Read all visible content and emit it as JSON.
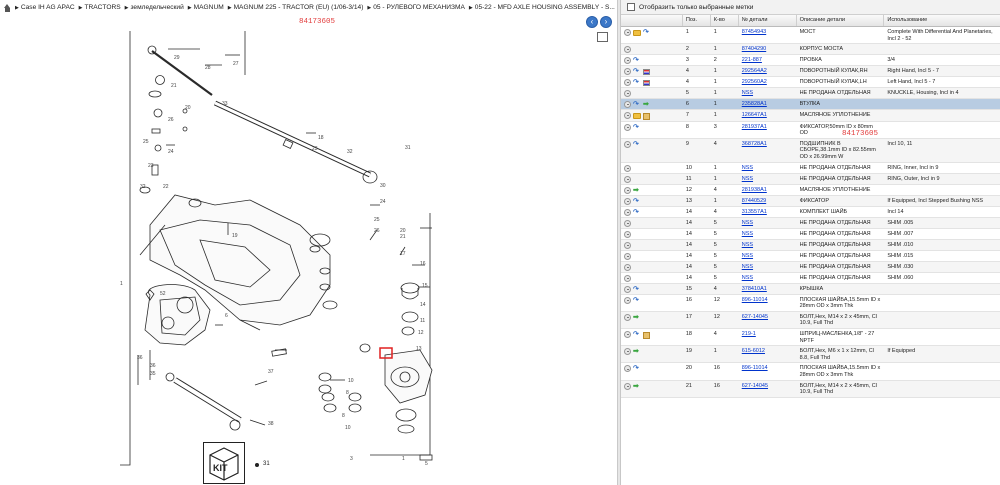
{
  "breadcrumb": [
    "Case IH AG APAC",
    "TRACTORS",
    "земледельческий",
    "MAGNUM",
    "MAGNUM 225 - TRACTOR (EU) (1/06-3/14)",
    "05 - РУЛЕВОГО МЕХАНИЗМА",
    "05-22 - MFD AXLE HOUSING ASSEMBLY - S..."
  ],
  "diagram": {
    "catalog_number": "84173605",
    "kit_label": "KIT",
    "kit_ref": "31"
  },
  "filter": {
    "label": "Отобразить только выбранные метки"
  },
  "table": {
    "headers": [
      "",
      "Поз.",
      "К-во",
      "№ детали",
      "Описание детали",
      "Использование"
    ],
    "selected_part_code": "84173605",
    "rows": [
      {
        "icons": [
          "plus",
          "folder",
          "return"
        ],
        "pos": "1",
        "qty": "1",
        "num": "87454943",
        "desc": "МОСТ",
        "use": "Complete With Differential And Planetaries, Incl 2 - 52"
      },
      {
        "icons": [
          "plus"
        ],
        "pos": "2",
        "qty": "1",
        "num": "87404290",
        "desc": "КОРПУС МОСТА",
        "use": ""
      },
      {
        "icons": [
          "plus",
          "return"
        ],
        "pos": "3",
        "qty": "2",
        "num": "221-887",
        "desc": "ПРОБКА",
        "use": "3/4"
      },
      {
        "icons": [
          "plus",
          "return",
          "flag"
        ],
        "pos": "4",
        "qty": "1",
        "num": "292564A2",
        "desc": "ПОВОРОТНЫЙ КУЛАК,RH",
        "use": "Right Hand, Incl 5 - 7"
      },
      {
        "icons": [
          "plus",
          "return",
          "flag"
        ],
        "pos": "4",
        "qty": "1",
        "num": "292560A2",
        "desc": "ПОВОРОТНЫЙ КУЛАК,LH",
        "use": "Left Hand, Incl 5 - 7"
      },
      {
        "icons": [
          "plus"
        ],
        "pos": "5",
        "qty": "1",
        "num": "NSS",
        "desc": "НЕ ПРОДАНА ОТДЕЛЬНАЯ",
        "use": "KNUCKLE, Housing, Incl in 4"
      },
      {
        "icons": [
          "plus",
          "return",
          "green"
        ],
        "pos": "6",
        "qty": "1",
        "num": "235828A1",
        "desc": "ВТУЛКА",
        "use": ""
      },
      {
        "icons": [
          "plus",
          "folder",
          "cube"
        ],
        "pos": "7",
        "qty": "1",
        "num": "126647A1",
        "desc": "МАСЛЯНОЕ УПЛОТНЕНИЕ",
        "use": ""
      },
      {
        "icons": [
          "plus",
          "return"
        ],
        "pos": "8",
        "qty": "3",
        "num": "281937A1",
        "desc": "ФИКСАТОР,50mm ID x 80mm OD",
        "use": ""
      },
      {
        "icons": [
          "plus",
          "return"
        ],
        "pos": "9",
        "qty": "4",
        "num": "368728A1",
        "desc": "ПОДШИПНИК В СБОРЕ,38.1mm ID x 82.55mm OD x 26.99mm W",
        "use": "Incl 10, 11"
      },
      {
        "icons": [
          "plus"
        ],
        "pos": "10",
        "qty": "1",
        "num": "NSS",
        "desc": "НЕ ПРОДАНА ОТДЕЛЬНАЯ",
        "use": "RING, Inner, Incl in 9"
      },
      {
        "icons": [
          "plus"
        ],
        "pos": "11",
        "qty": "1",
        "num": "NSS",
        "desc": "НЕ ПРОДАНА ОТДЕЛЬНАЯ",
        "use": "RING, Outer, Incl in 9"
      },
      {
        "icons": [
          "plus",
          "green"
        ],
        "pos": "12",
        "qty": "4",
        "num": "281938A1",
        "desc": "МАСЛЯНОЕ УПЛОТНЕНИЕ",
        "use": ""
      },
      {
        "icons": [
          "plus",
          "return"
        ],
        "pos": "13",
        "qty": "1",
        "num": "87440529",
        "desc": "ФИКСАТОР",
        "use": "If Equipped, Incl Stepped Bushing NSS"
      },
      {
        "icons": [
          "plus",
          "return"
        ],
        "pos": "14",
        "qty": "4",
        "num": "313557A1",
        "desc": "КОМПЛЕКТ ШАЙБ",
        "use": "Incl 14"
      },
      {
        "icons": [
          "plus"
        ],
        "pos": "14",
        "qty": "5",
        "num": "NSS",
        "desc": "НЕ ПРОДАНА ОТДЕЛЬНАЯ",
        "use": "SHIM .005"
      },
      {
        "icons": [
          "plus"
        ],
        "pos": "14",
        "qty": "5",
        "num": "NSS",
        "desc": "НЕ ПРОДАНА ОТДЕЛЬНАЯ",
        "use": "SHIM .007"
      },
      {
        "icons": [
          "plus"
        ],
        "pos": "14",
        "qty": "5",
        "num": "NSS",
        "desc": "НЕ ПРОДАНА ОТДЕЛЬНАЯ",
        "use": "SHIM .010"
      },
      {
        "icons": [
          "plus"
        ],
        "pos": "14",
        "qty": "5",
        "num": "NSS",
        "desc": "НЕ ПРОДАНА ОТДЕЛЬНАЯ",
        "use": "SHIM .015"
      },
      {
        "icons": [
          "plus"
        ],
        "pos": "14",
        "qty": "5",
        "num": "NSS",
        "desc": "НЕ ПРОДАНА ОТДЕЛЬНАЯ",
        "use": "SHIM .030"
      },
      {
        "icons": [
          "plus"
        ],
        "pos": "14",
        "qty": "5",
        "num": "NSS",
        "desc": "НЕ ПРОДАНА ОТДЕЛЬНАЯ",
        "use": "SHIM .060"
      },
      {
        "icons": [
          "plus",
          "return"
        ],
        "pos": "15",
        "qty": "4",
        "num": "378410A1",
        "desc": "КРЫШКА",
        "use": ""
      },
      {
        "icons": [
          "plus",
          "return"
        ],
        "pos": "16",
        "qty": "12",
        "num": "896-11014",
        "desc": "ПЛОСКАЯ ШАЙБА,15.5mm ID x 28mm OD x 3mm Thk",
        "use": ""
      },
      {
        "icons": [
          "plus",
          "green"
        ],
        "pos": "17",
        "qty": "12",
        "num": "627-14045",
        "desc": "БОЛТ,Hex, M14 x 2 x 45mm, Cl 10.9, Full Thd",
        "use": ""
      },
      {
        "icons": [
          "plus",
          "return",
          "cube"
        ],
        "pos": "18",
        "qty": "4",
        "num": "219-1",
        "desc": "ШПРИЦ-МАСЛЕНКА,1/8\" - 27 NPTF",
        "use": ""
      },
      {
        "icons": [
          "plus",
          "green"
        ],
        "pos": "19",
        "qty": "1",
        "num": "615-6012",
        "desc": "БОЛТ,Hex, M6 x 1 x 12mm, Cl 8.8, Full Thd",
        "use": "If Equipped"
      },
      {
        "icons": [
          "plus",
          "return"
        ],
        "pos": "20",
        "qty": "16",
        "num": "896-11014",
        "desc": "ПЛОСКАЯ ШАЙБА,15.5mm ID x 28mm OD x 3mm Thk",
        "use": ""
      },
      {
        "icons": [
          "plus",
          "green"
        ],
        "pos": "21",
        "qty": "16",
        "num": "627-14045",
        "desc": "БОЛТ,Hex, M14 x 2 x 45mm, Cl 10.9, Full Thd",
        "use": ""
      }
    ]
  }
}
